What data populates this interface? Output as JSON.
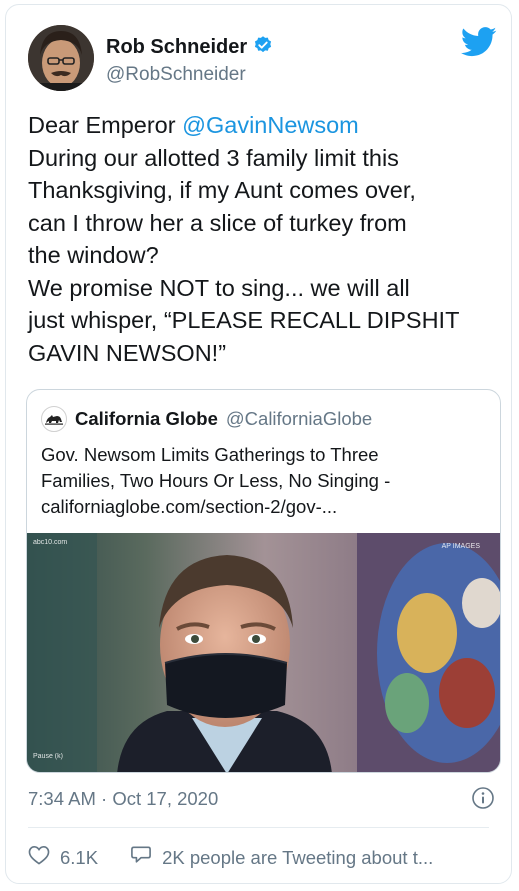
{
  "author": {
    "display_name": "Rob Schneider",
    "handle": "@RobSchneider",
    "verified_icon": "verified-badge-icon"
  },
  "tweet": {
    "line1_prefix": "Dear Emperor ",
    "line1_mention": "@GavinNewsom",
    "body": "During our allotted 3 family limit this\nThanksgiving, if my Aunt comes over,\ncan I throw her a slice of turkey from\nthe window?\nWe promise NOT to sing... we will all\njust whisper, “PLEASE RECALL DIPSHIT\nGAVIN NEWSON!”"
  },
  "quoted": {
    "name": "California Globe",
    "handle": "@CaliforniaGlobe",
    "text": "Gov. Newsom Limits Gatherings to Three\nFamilies, Two Hours Or Less, No Singing -\ncaliforniaglobe.com/section-2/gov-...",
    "image": {
      "watermark_left": "abc10.com",
      "watermark_right": "AP IMAGES",
      "caption": "Pause (k)"
    }
  },
  "meta": {
    "timestamp": "7:34 AM · Oct 17, 2020"
  },
  "actions": {
    "likes": "6.1K",
    "conversation": "2K people are Tweeting about t..."
  },
  "colors": {
    "accent": "#1da1f2",
    "link": "#1b95e0",
    "secondary_text": "#657786",
    "border": "#e1e8ed"
  }
}
